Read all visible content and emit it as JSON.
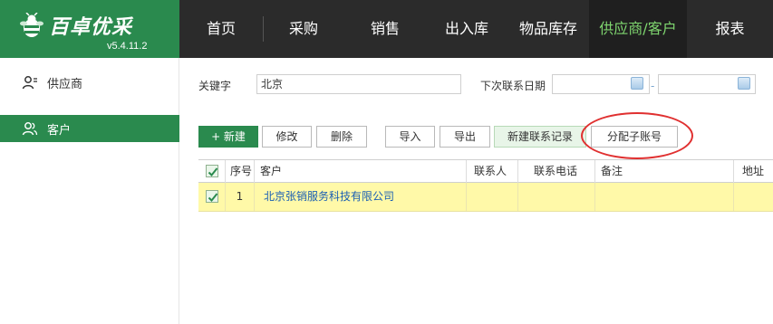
{
  "app": {
    "brand": "百卓优采",
    "version": "v5.4.11.2"
  },
  "nav": {
    "items": [
      {
        "label": "首页"
      },
      {
        "label": "采购"
      },
      {
        "label": "销售"
      },
      {
        "label": "出入库"
      },
      {
        "label": "物品库存"
      },
      {
        "label": "供应商/客户",
        "active": true
      },
      {
        "label": "报表"
      }
    ]
  },
  "sidebar": {
    "items": [
      {
        "label": "供应商",
        "icon": "user-icon"
      },
      {
        "label": "客户",
        "icon": "users-icon",
        "active": true
      }
    ]
  },
  "search": {
    "keyword_label": "关键字",
    "keyword_value": "北京",
    "date_label": "下次联系日期",
    "date_from": "",
    "date_to": "",
    "date_separator": "-"
  },
  "toolbar": {
    "new_label": "+ 新建",
    "edit_label": "修改",
    "delete_label": "删除",
    "import_label": "导入",
    "export_label": "导出",
    "new_contact_label": "新建联系记录",
    "assign_label": "分配子账号"
  },
  "table": {
    "columns": [
      "序号",
      "客户",
      "联系人",
      "联系电话",
      "备注",
      "地址"
    ],
    "rows": [
      {
        "index": "1",
        "customer": "北京张销服务科技有限公司",
        "contact": "",
        "phone": "",
        "note": "",
        "address": ""
      }
    ]
  },
  "colors": {
    "brand_green": "#2a8a4e",
    "topbar": "#2b2b2b",
    "active_nav_text": "#7fd66f",
    "selected_row": "#fff9a8",
    "highlight_ring": "#e03030"
  }
}
